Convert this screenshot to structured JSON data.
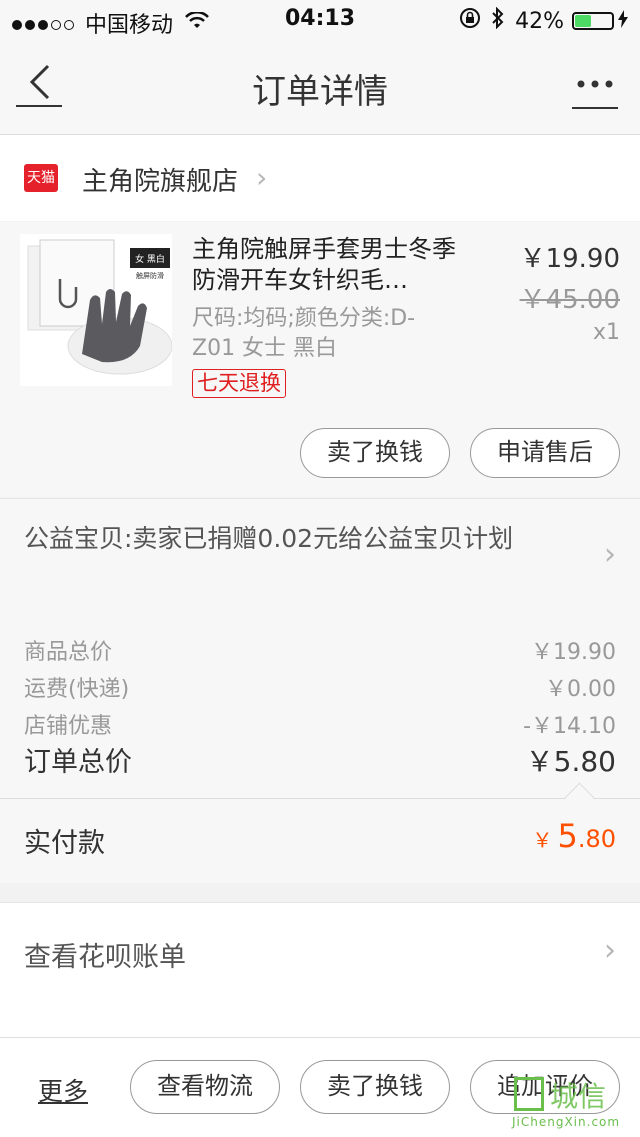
{
  "status_bar": {
    "carrier": "中国移动",
    "time": "04:13",
    "battery": "42%",
    "battery_level": 0.42,
    "signal_dots_filled": 3,
    "signal_dots_total": 5
  },
  "nav": {
    "title": "订单详情",
    "back_icon": "chevron-left-icon",
    "more_icon": "ellipsis-icon"
  },
  "shop": {
    "badge": "天猫",
    "name": "主角院旗舰店"
  },
  "item": {
    "title": "主角院触屏手套男士冬季防滑开车女针织毛…",
    "sku": "尺码:均码;颜色分类:D-Z01 女士 黑白",
    "tag": "七天退换",
    "price": "￥19.90",
    "original_price": "￥45.00",
    "quantity": "x1",
    "thumb_text": "女 黑白",
    "thumb_sub": "触屏防滑",
    "actions": [
      "卖了换钱",
      "申请售后"
    ]
  },
  "donation": {
    "text": "公益宝贝:卖家已捐赠0.02元给公益宝贝计划"
  },
  "summary": {
    "rows": [
      {
        "label": "商品总价",
        "value": "￥19.90"
      },
      {
        "label": "运费(快递)",
        "value": "￥0.00"
      },
      {
        "label": "店铺优惠",
        "value": "-￥14.10"
      }
    ],
    "total_label": "订单总价",
    "total_value": "￥5.80"
  },
  "paid": {
    "label": "实付款",
    "currency": "￥",
    "integer": "5",
    "decimal": ".80"
  },
  "huabei": {
    "label": "查看花呗账单"
  },
  "bottom_bar": {
    "more": "更多",
    "buttons": [
      "查看物流",
      "卖了换钱",
      "追加评价"
    ]
  },
  "watermark": {
    "brand": "城信",
    "url": "JiChengXin.com"
  },
  "colors": {
    "accent": "#ff5000",
    "tmall_red": "#e5222c",
    "tag_red": "#e02020",
    "battery_green": "#4cd964"
  }
}
